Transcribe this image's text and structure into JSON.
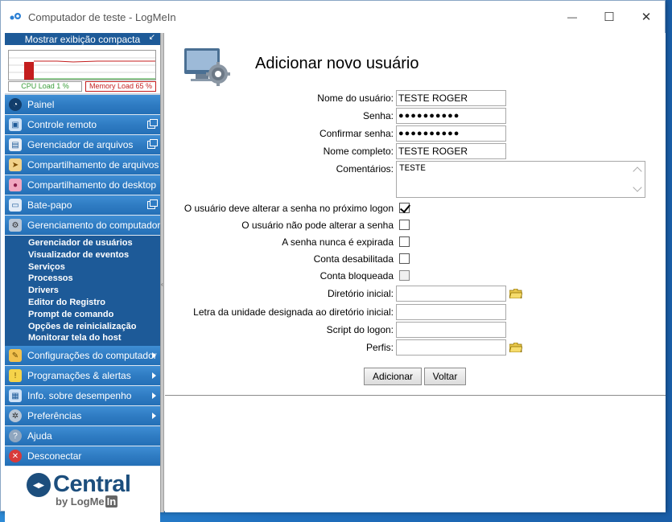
{
  "window": {
    "title": "Computador de teste - LogMeIn",
    "controls": {
      "minimize": "—",
      "maximize": "☐",
      "close": "✕"
    }
  },
  "sidebar": {
    "compact_toggle": "Mostrar exibição compacta",
    "monitor": {
      "cpu_label": "CPU Load 1 %",
      "memory_label": "Memory Load 65 %",
      "cpu_load": 1,
      "memory_load": 65
    },
    "items_top": [
      {
        "label": "Painel",
        "icon": "dashboard-icon"
      },
      {
        "label": "Controle remoto",
        "icon": "remote-control-icon"
      },
      {
        "label": "Gerenciador de arquivos",
        "icon": "file-manager-icon"
      },
      {
        "label": "Compartilhamento de arquivos",
        "icon": "file-sharing-icon"
      },
      {
        "label": "Compartilhamento do desktop",
        "icon": "desktop-sharing-icon"
      },
      {
        "label": "Bate-papo",
        "icon": "chat-icon"
      },
      {
        "label": "Gerenciamento do computador",
        "icon": "computer-management-icon"
      }
    ],
    "subitems": [
      "Gerenciador de usuários",
      "Visualizador de eventos",
      "Serviços",
      "Processos",
      "Drivers",
      "Editor do Registro",
      "Prompt de comando",
      "Opções de reinicialização",
      "Monitorar tela do host"
    ],
    "items_bottom": [
      {
        "label": "Configurações do computador",
        "icon": "computer-settings-icon"
      },
      {
        "label": "Programações & alertas",
        "icon": "alerts-icon"
      },
      {
        "label": "Info. sobre desempenho",
        "icon": "performance-icon"
      },
      {
        "label": "Preferências",
        "icon": "preferences-icon"
      },
      {
        "label": "Ajuda",
        "icon": "help-icon"
      },
      {
        "label": "Desconectar",
        "icon": "disconnect-icon"
      }
    ],
    "logo": {
      "word": "Central",
      "by": "by LogMe",
      "in": "In"
    }
  },
  "main": {
    "title": "Adicionar novo usuário",
    "fields": {
      "username": {
        "label": "Nome do usuário:",
        "value": "TESTE ROGER"
      },
      "password": {
        "label": "Senha:",
        "value": "●●●●●●●●●●"
      },
      "confirm_password": {
        "label": "Confirmar senha:",
        "value": "●●●●●●●●●●"
      },
      "full_name": {
        "label": "Nome completo:",
        "value": "TESTE ROGER"
      },
      "comments": {
        "label": "Comentários:",
        "value": "TESTE"
      },
      "must_change": {
        "label": "O usuário deve alterar a senha no próximo logon",
        "checked": true
      },
      "cannot_change": {
        "label": "O usuário não pode alterar a senha",
        "checked": false
      },
      "never_expires": {
        "label": "A senha nunca é expirada",
        "checked": false
      },
      "disabled": {
        "label": "Conta desabilitada",
        "checked": false
      },
      "locked": {
        "label": "Conta bloqueada",
        "checked": false
      },
      "home_dir": {
        "label": "Diretório inicial:",
        "value": ""
      },
      "home_drive": {
        "label": "Letra da unidade designada ao diretório inicial:",
        "value": ""
      },
      "logon_script": {
        "label": "Script do logon:",
        "value": ""
      },
      "profiles": {
        "label": "Perfis:",
        "value": ""
      }
    },
    "buttons": {
      "add": "Adicionar",
      "back": "Voltar"
    }
  }
}
